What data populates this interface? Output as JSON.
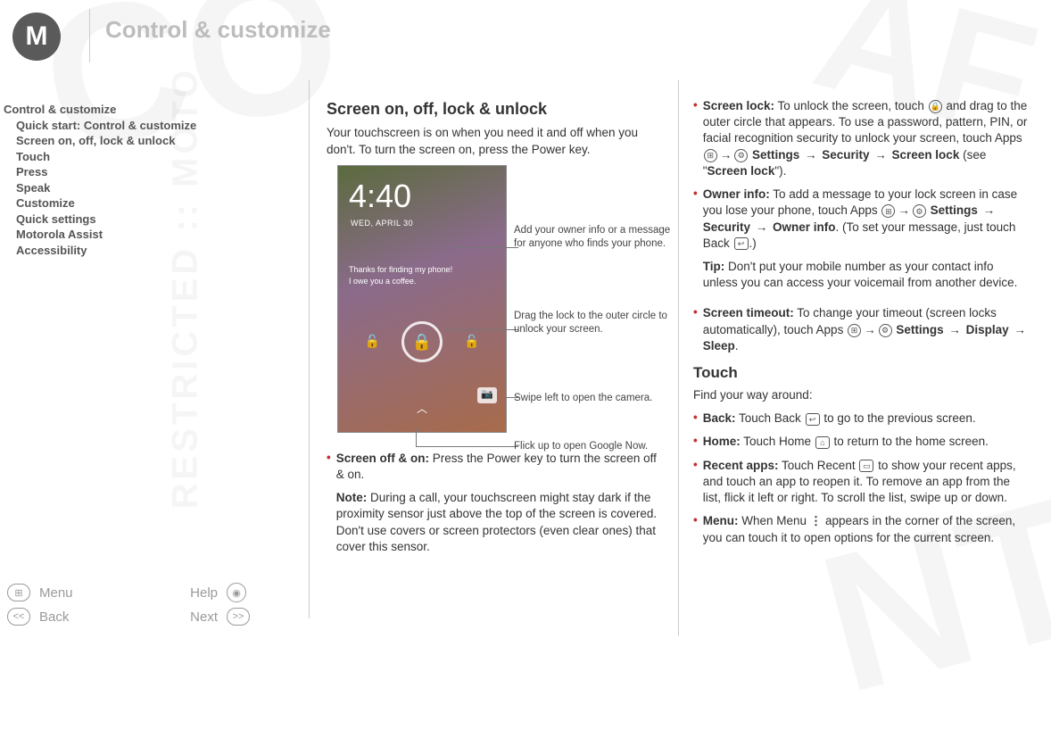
{
  "header": {
    "title": "Control & customize",
    "logo_letter": "M"
  },
  "toc": {
    "root": "Control & customize",
    "items": [
      "Quick start: Control & customize",
      "Screen on, off, lock & unlock",
      "Touch",
      "Press",
      "Speak",
      "Customize",
      "Quick settings",
      "Motorola Assist",
      "Accessibility"
    ]
  },
  "nav": {
    "menu": "Menu",
    "help": "Help",
    "back": "Back",
    "next": "Next",
    "menu_glyph": "⊞",
    "help_glyph": "◉",
    "back_glyph": "<<",
    "next_glyph": ">>"
  },
  "col1": {
    "h": "Screen on, off, lock & unlock",
    "intro": "Your touchscreen is on when you need it and off when you don't. To turn the screen on, press the Power key.",
    "phone": {
      "time": "4:40",
      "date": "WED, APRIL 30",
      "owner_l1": "Thanks for finding my phone!",
      "owner_l2": "I owe you a coffee."
    },
    "callouts": {
      "owner": "Add your owner info or a message for anyone who finds your phone.",
      "drag": "Drag the lock to the outer circle to unlock your screen.",
      "camera": "Swipe left to open the camera.",
      "gnow": "Flick up to open Google Now."
    },
    "b1_label": "Screen off & on:",
    "b1_text": " Press the Power key to turn the screen off & on.",
    "note_label": "Note:",
    "note_text": " During a call, your touchscreen might stay dark if the proximity sensor just above the top of the screen is covered. Don't use covers or screen protectors (even clear ones) that cover this sensor."
  },
  "col2": {
    "sl_label": "Screen lock:",
    "sl_t1": " To unlock the screen, touch ",
    "sl_t2": " and drag to the outer circle that appears. To use a password, pattern, PIN, or facial recognition security to unlock your screen, touch Apps ",
    "sl_t3": " Settings ",
    "sl_t4": " Security ",
    "sl_t5": " Screen lock",
    "sl_t6": " (see \"",
    "sl_t7": "Screen lock",
    "sl_t8": "\").",
    "oi_label": "Owner info:",
    "oi_t1": " To add a message to your lock screen in case you lose your phone, touch Apps ",
    "oi_t2": " Settings ",
    "oi_t3": " Security ",
    "oi_t4": " Owner info",
    "oi_t5": ". (To set your message, just touch Back ",
    "oi_t6": ".)",
    "tip_label": "Tip:",
    "tip_text": " Don't put your mobile number as your contact info unless you can access your voicemail from another device.",
    "st_label": "Screen timeout:",
    "st_t1": " To change your timeout (screen locks automatically), touch Apps ",
    "st_t2": " Settings ",
    "st_t3": " Display ",
    "st_t4": " Sleep",
    "st_t5": ".",
    "touch_h": "Touch",
    "touch_intro": "Find your way around:",
    "back_label": "Back:",
    "back_text": " Touch Back ",
    "back_text2": " to go to the previous screen.",
    "home_label": "Home:",
    "home_text": " Touch Home ",
    "home_text2": " to return to the home screen.",
    "recent_label": "Recent apps:",
    "recent_text": " Touch Recent ",
    "recent_text2": " to show your recent apps, and touch an app to reopen it. To remove an app from the list, flick it left or right. To scroll the list, swipe up or down.",
    "menu_label": "Menu:",
    "menu_text": " When Menu ",
    "menu_text2": " appears in the corner of the screen, you can touch it to open options for the current screen."
  },
  "glyphs": {
    "arrow": "→",
    "back_arrow": "↩",
    "apps": "⊞",
    "gear": "⚙",
    "lock": "🔒",
    "home": "⌂",
    "recent": "▭",
    "menu_dots": "⋮",
    "lock_small": "🔓"
  }
}
